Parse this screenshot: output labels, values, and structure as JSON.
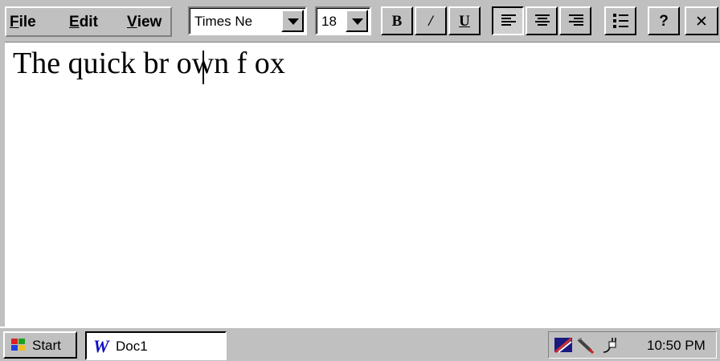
{
  "menu": {
    "file_label": "File",
    "file_key": "F",
    "file_rest": "ile",
    "edit_key": "E",
    "edit_rest": "dit",
    "view_key": "V",
    "view_rest": "iew"
  },
  "toolbar": {
    "font_value": "Times Ne",
    "size_value": "18",
    "bold_glyph": "B",
    "italic_glyph": "/",
    "underline_glyph": "U",
    "help_glyph": "?",
    "close_glyph": "✕",
    "align_left_active": true
  },
  "document": {
    "text": "The quick br own f ox"
  },
  "taskbar": {
    "start_label": "Start",
    "task_label": "Doc1",
    "clock": "10:50 PM"
  },
  "colors": {
    "face": "#c0c0c0",
    "highlight": "#ffffff",
    "shadow": "#808080",
    "word_icon": "#1010c0"
  }
}
